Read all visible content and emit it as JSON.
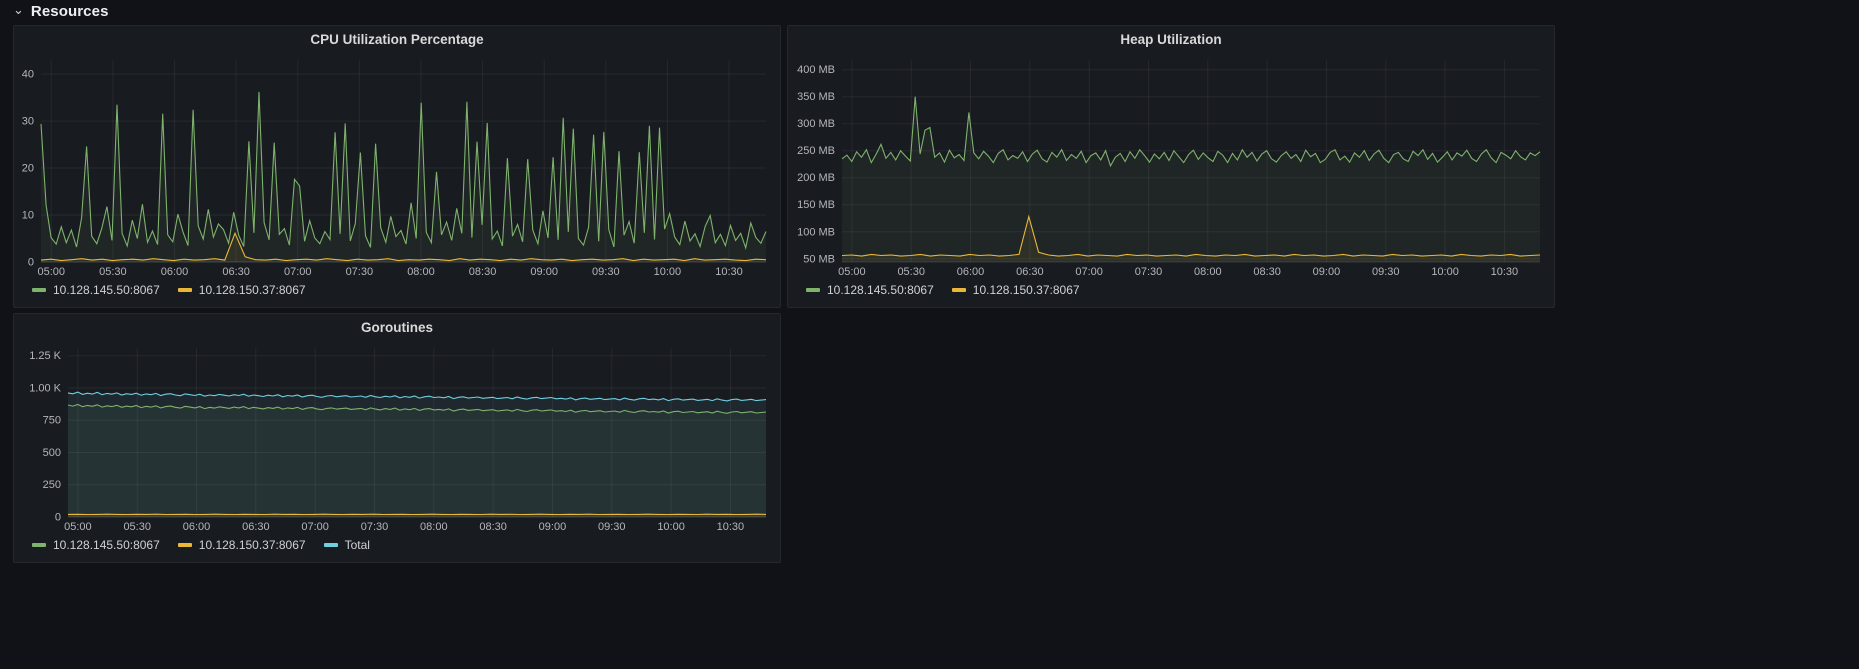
{
  "section": {
    "title": "Resources",
    "collapse_icon": "chevron-down"
  },
  "theme": {
    "background": "#111217",
    "panel_background": "#181b1f",
    "panel_border": "#25272e",
    "text": "#ccccdc",
    "grid": "rgba(204,204,220,0.08)",
    "series_green": "#7eb26d",
    "series_yellow": "#eab839",
    "series_cyan": "#6ed0e0"
  },
  "chart_data": [
    {
      "id": "cpu",
      "type": "line",
      "title": "CPU Utilization Percentage",
      "xlabel": "",
      "ylabel": "",
      "ylim": [
        0,
        43
      ],
      "grid": true,
      "legend_position": "bottom",
      "y_ticks": [
        {
          "v": 0,
          "label": "0"
        },
        {
          "v": 10,
          "label": "10"
        },
        {
          "v": 20,
          "label": "20"
        },
        {
          "v": 30,
          "label": "30"
        },
        {
          "v": 40,
          "label": "40"
        }
      ],
      "x_start_min": 295,
      "x_end_min": 648,
      "x_ticks": [
        {
          "min": 300,
          "label": "05:00"
        },
        {
          "min": 330,
          "label": "05:30"
        },
        {
          "min": 360,
          "label": "06:00"
        },
        {
          "min": 390,
          "label": "06:30"
        },
        {
          "min": 420,
          "label": "07:00"
        },
        {
          "min": 450,
          "label": "07:30"
        },
        {
          "min": 480,
          "label": "08:00"
        },
        {
          "min": 510,
          "label": "08:30"
        },
        {
          "min": 540,
          "label": "09:00"
        },
        {
          "min": 570,
          "label": "09:30"
        },
        {
          "min": 600,
          "label": "10:00"
        },
        {
          "min": 630,
          "label": "10:30"
        }
      ],
      "series": [
        {
          "name": "10.128.145.50:8067",
          "color": "#7eb26d",
          "values": [
            29.4,
            12.1,
            5.2,
            3.8,
            7.5,
            4.1,
            6.8,
            3.2,
            9.4,
            24.6,
            5.5,
            3.9,
            7.2,
            11.8,
            4.6,
            33.5,
            6.1,
            3.4,
            8.9,
            5.0,
            12.3,
            4.2,
            6.6,
            3.7,
            31.6,
            5.8,
            4.3,
            10.2,
            6.4,
            3.5,
            32.4,
            7.7,
            4.9,
            11.2,
            5.3,
            8.1,
            6.9,
            4.0,
            10.6,
            5.7,
            3.3,
            25.7,
            6.2,
            36.2,
            8.4,
            4.7,
            25.4,
            5.9,
            7.1,
            3.6,
            17.6,
            16.2,
            4.4,
            8.8,
            5.1,
            3.9,
            6.5,
            4.8,
            27.6,
            6.0,
            29.5,
            4.5,
            8.2,
            23.3,
            5.6,
            3.1,
            25.2,
            7.3,
            4.2,
            9.7,
            5.4,
            6.7,
            3.8,
            12.6,
            5.0,
            33.9,
            6.3,
            4.1,
            19.2,
            5.8,
            8.5,
            4.6,
            11.4,
            6.1,
            34.1,
            5.2,
            25.6,
            7.9,
            29.6,
            4.9,
            6.6,
            3.4,
            22.1,
            5.5,
            8.0,
            4.3,
            21.9,
            6.8,
            3.9,
            10.9,
            5.1,
            22.3,
            4.7,
            30.7,
            6.4,
            28.4,
            5.0,
            3.6,
            7.4,
            27.1,
            4.4,
            27.7,
            6.9,
            3.2,
            23.6,
            5.7,
            8.6,
            4.0,
            23.4,
            6.2,
            29.0,
            4.8,
            28.6,
            7.0,
            10.3,
            5.3,
            3.7,
            8.7,
            4.5,
            6.0,
            3.3,
            7.6,
            9.9,
            4.1,
            5.9,
            3.5,
            7.8,
            4.6,
            6.1,
            3.0,
            8.3,
            5.2,
            4.0,
            6.5
          ]
        },
        {
          "name": "10.128.150.37:8067",
          "color": "#eab839",
          "values": [
            0.4,
            0.6,
            0.3,
            0.5,
            0.7,
            0.4,
            0.6,
            0.3,
            0.5,
            0.6,
            0.4,
            0.7,
            0.5,
            0.3,
            0.6,
            0.4,
            0.5,
            0.7,
            0.4,
            6.1,
            1.1,
            0.5,
            0.4,
            0.6,
            0.3,
            0.5,
            0.6,
            0.4,
            0.7,
            0.5,
            0.3,
            0.6,
            0.4,
            0.5,
            0.7,
            0.3,
            0.5,
            0.4,
            0.6,
            0.5,
            0.3,
            0.7,
            0.4,
            0.6,
            0.5,
            0.3,
            0.6,
            0.4,
            0.7,
            0.5,
            0.4,
            0.6,
            0.3,
            0.5,
            0.6,
            0.4,
            0.5,
            0.7,
            0.3,
            0.6,
            0.4,
            0.5,
            0.6,
            0.3,
            0.7,
            0.4,
            0.5,
            0.6,
            0.4,
            0.3,
            0.6,
            0.5
          ]
        }
      ]
    },
    {
      "id": "heap",
      "type": "line",
      "title": "Heap Utilization",
      "xlabel": "",
      "ylabel": "",
      "ylim": [
        44,
        418
      ],
      "grid": true,
      "legend_position": "bottom",
      "y_ticks": [
        {
          "v": 50,
          "label": "50 MB"
        },
        {
          "v": 100,
          "label": "100 MB"
        },
        {
          "v": 150,
          "label": "150 MB"
        },
        {
          "v": 200,
          "label": "200 MB"
        },
        {
          "v": 250,
          "label": "250 MB"
        },
        {
          "v": 300,
          "label": "300 MB"
        },
        {
          "v": 350,
          "label": "350 MB"
        },
        {
          "v": 400,
          "label": "400 MB"
        }
      ],
      "x_start_min": 295,
      "x_end_min": 648,
      "x_ticks": [
        {
          "min": 300,
          "label": "05:00"
        },
        {
          "min": 330,
          "label": "05:30"
        },
        {
          "min": 360,
          "label": "06:00"
        },
        {
          "min": 390,
          "label": "06:30"
        },
        {
          "min": 420,
          "label": "07:00"
        },
        {
          "min": 450,
          "label": "07:30"
        },
        {
          "min": 480,
          "label": "08:00"
        },
        {
          "min": 510,
          "label": "08:30"
        },
        {
          "min": 540,
          "label": "09:00"
        },
        {
          "min": 570,
          "label": "09:30"
        },
        {
          "min": 600,
          "label": "10:00"
        },
        {
          "min": 630,
          "label": "10:30"
        }
      ],
      "series": [
        {
          "name": "10.128.145.50:8067",
          "color": "#7eb26d",
          "values": [
            235,
            242,
            230,
            248,
            238,
            252,
            228,
            244,
            262,
            236,
            247,
            233,
            250,
            240,
            231,
            350,
            244,
            288,
            293,
            238,
            246,
            229,
            251,
            237,
            243,
            232,
            321,
            246,
            235,
            249,
            240,
            228,
            245,
            252,
            233,
            241,
            236,
            248,
            230,
            244,
            251,
            235,
            229,
            247,
            238,
            252,
            232,
            243,
            236,
            249,
            228,
            241,
            246,
            233,
            250,
            222,
            238,
            245,
            230,
            248,
            236,
            252,
            241,
            229,
            244,
            235,
            247,
            232,
            250,
            239,
            228,
            243,
            251,
            234,
            246,
            237,
            230,
            249,
            242,
            228,
            245,
            233,
            252,
            238,
            247,
            231,
            244,
            250,
            235,
            229,
            241,
            248,
            236,
            243,
            230,
            251,
            239,
            245,
            228,
            234,
            247,
            252,
            233,
            240,
            229,
            246,
            238,
            250,
            232,
            244,
            251,
            236,
            228,
            243,
            247,
            235,
            230,
            249,
            241,
            252,
            234,
            245,
            229,
            238,
            248,
            233,
            246,
            240,
            251,
            236,
            230,
            244,
            252,
            237,
            228,
            247,
            242,
            235,
            250,
            239,
            233,
            246,
            241,
            248
          ]
        },
        {
          "name": "10.128.150.37:8067",
          "color": "#eab839",
          "values": [
            56,
            57,
            55,
            58,
            56,
            57,
            55,
            56,
            58,
            55,
            57,
            56,
            55,
            58,
            56,
            57,
            55,
            56,
            58,
            128,
            62,
            57,
            55,
            56,
            58,
            55,
            57,
            56,
            55,
            58,
            56,
            57,
            55,
            56,
            57,
            55,
            58,
            56,
            55,
            57,
            56,
            58,
            55,
            56,
            57,
            55,
            58,
            56,
            57,
            55,
            56,
            58,
            55,
            57,
            56,
            55,
            58,
            56,
            57,
            55,
            56,
            57,
            55,
            58,
            56,
            55,
            57,
            56,
            58,
            55,
            56,
            57
          ]
        }
      ]
    },
    {
      "id": "goroutines",
      "type": "line",
      "title": "Goroutines",
      "xlabel": "",
      "ylabel": "",
      "ylim": [
        0,
        1310
      ],
      "grid": true,
      "legend_position": "bottom",
      "y_ticks": [
        {
          "v": 0,
          "label": "0"
        },
        {
          "v": 250,
          "label": "250"
        },
        {
          "v": 500,
          "label": "500"
        },
        {
          "v": 750,
          "label": "750"
        },
        {
          "v": 1000,
          "label": "1.00 K"
        },
        {
          "v": 1250,
          "label": "1.25 K"
        }
      ],
      "x_start_min": 295,
      "x_end_min": 648,
      "x_ticks": [
        {
          "min": 300,
          "label": "05:00"
        },
        {
          "min": 330,
          "label": "05:30"
        },
        {
          "min": 360,
          "label": "06:00"
        },
        {
          "min": 390,
          "label": "06:30"
        },
        {
          "min": 420,
          "label": "07:00"
        },
        {
          "min": 450,
          "label": "07:30"
        },
        {
          "min": 480,
          "label": "08:00"
        },
        {
          "min": 510,
          "label": "08:30"
        },
        {
          "min": 540,
          "label": "09:00"
        },
        {
          "min": 570,
          "label": "09:30"
        },
        {
          "min": 600,
          "label": "10:00"
        },
        {
          "min": 630,
          "label": "10:30"
        }
      ],
      "series": [
        {
          "name": "10.128.145.50:8067",
          "color": "#7eb26d",
          "values": [
            868,
            860,
            872,
            855,
            865,
            858,
            870,
            852,
            862,
            856,
            866,
            850,
            860,
            854,
            864,
            848,
            858,
            852,
            862,
            846,
            856,
            860,
            850,
            844,
            858,
            852,
            846,
            856,
            840,
            850,
            844,
            854,
            848,
            842,
            852,
            846,
            856,
            840,
            850,
            844,
            838,
            848,
            842,
            852,
            836,
            846,
            840,
            850,
            834,
            844,
            848,
            838,
            832,
            842,
            846,
            836,
            840,
            844,
            834,
            838,
            842,
            832,
            846,
            836,
            830,
            840,
            834,
            844,
            828,
            838,
            832,
            842,
            826,
            836,
            840,
            830,
            834,
            828,
            838,
            822,
            832,
            836,
            826,
            830,
            834,
            824,
            828,
            832,
            822,
            826,
            830,
            820,
            834,
            824,
            818,
            828,
            832,
            822,
            826,
            830,
            820,
            824,
            818,
            828,
            812,
            822,
            826,
            816,
            820,
            824,
            814,
            818,
            822,
            812,
            826,
            816,
            810,
            820,
            824,
            814,
            818,
            812,
            822,
            806,
            816,
            820,
            810,
            814,
            818,
            808,
            812,
            816,
            806,
            820,
            810,
            804,
            814,
            818,
            808,
            812,
            816,
            806,
            810,
            814
          ]
        },
        {
          "name": "10.128.150.37:8067",
          "color": "#eab839",
          "values": [
            20,
            21,
            19,
            20,
            22,
            20,
            19,
            21,
            20,
            22,
            19,
            20,
            21,
            19,
            20,
            22,
            20,
            19,
            21,
            20,
            19,
            22,
            20,
            21,
            19,
            20,
            22,
            20,
            19,
            21,
            20,
            22,
            19,
            20,
            21,
            19,
            20,
            22,
            20,
            19,
            21,
            20,
            19,
            22,
            20,
            21,
            19,
            20,
            22,
            20,
            19,
            21,
            20,
            22,
            19,
            20,
            21,
            19,
            20,
            22,
            20,
            19,
            21,
            20,
            19,
            22,
            20,
            21,
            19,
            20,
            22,
            20
          ]
        },
        {
          "name": "Total",
          "color": "#6ed0e0",
          "values": [
            962,
            955,
            968,
            950,
            960,
            953,
            966,
            948,
            958,
            952,
            962,
            946,
            956,
            950,
            960,
            944,
            954,
            948,
            958,
            942,
            952,
            956,
            946,
            940,
            954,
            948,
            942,
            952,
            936,
            946,
            940,
            950,
            944,
            938,
            948,
            942,
            952,
            936,
            946,
            940,
            934,
            944,
            938,
            948,
            932,
            942,
            936,
            946,
            930,
            940,
            944,
            934,
            928,
            938,
            942,
            932,
            936,
            940,
            930,
            934,
            938,
            928,
            942,
            932,
            926,
            936,
            930,
            940,
            924,
            934,
            928,
            938,
            922,
            932,
            936,
            926,
            930,
            924,
            934,
            918,
            928,
            932,
            922,
            926,
            930,
            920,
            924,
            928,
            918,
            922,
            926,
            916,
            930,
            920,
            914,
            924,
            928,
            918,
            922,
            926,
            916,
            920,
            914,
            924,
            908,
            918,
            922,
            912,
            916,
            920,
            910,
            914,
            918,
            908,
            922,
            912,
            906,
            916,
            920,
            910,
            914,
            908,
            918,
            902,
            912,
            916,
            906,
            910,
            914,
            904,
            908,
            912,
            902,
            916,
            906,
            900,
            910,
            914,
            904,
            908,
            912,
            902,
            906,
            910
          ]
        }
      ]
    }
  ]
}
